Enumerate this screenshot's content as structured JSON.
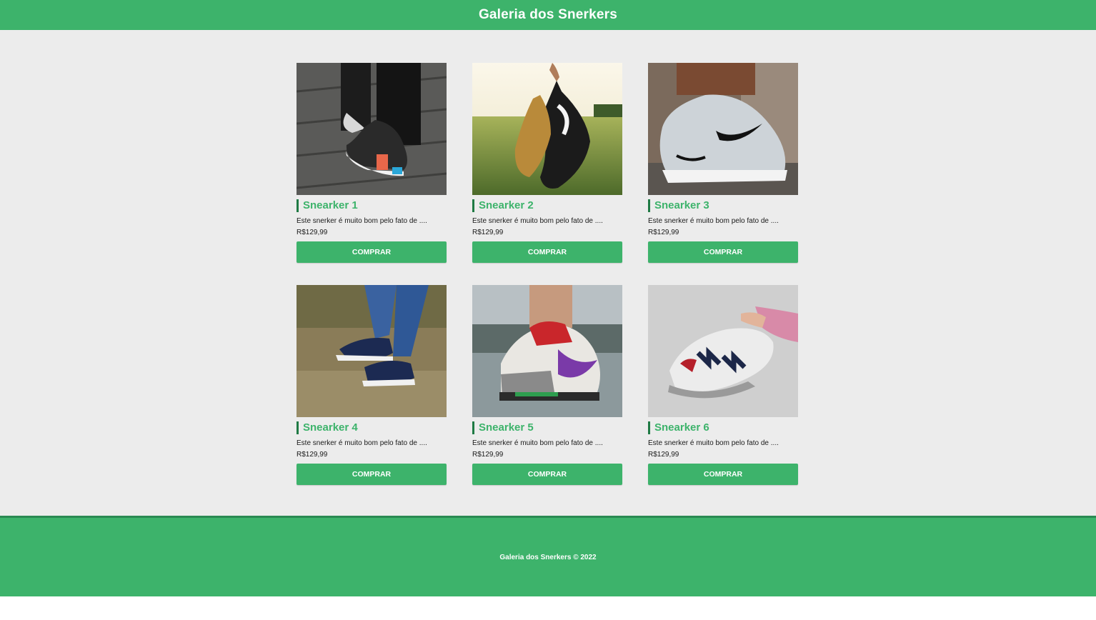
{
  "header": {
    "title": "Galeria dos Snerkers"
  },
  "products": [
    {
      "name": "Snearker 1",
      "description": "Este snerker é muito bom pelo fato de ....",
      "price": "R$129,99",
      "button_label": "COMPRAR",
      "image_icon": "sneaker-photo-icon"
    },
    {
      "name": "Snearker 2",
      "description": "Este snerker é muito bom pelo fato de ....",
      "price": "R$129,99",
      "button_label": "COMPRAR",
      "image_icon": "sneaker-photo-icon"
    },
    {
      "name": "Snearker 3",
      "description": "Este snerker é muito bom pelo fato de ....",
      "price": "R$129,99",
      "button_label": "COMPRAR",
      "image_icon": "sneaker-photo-icon"
    },
    {
      "name": "Snearker 4",
      "description": "Este snerker é muito bom pelo fato de ....",
      "price": "R$129,99",
      "button_label": "COMPRAR",
      "image_icon": "sneaker-photo-icon"
    },
    {
      "name": "Snearker 5",
      "description": "Este snerker é muito bom pelo fato de ....",
      "price": "R$129,99",
      "button_label": "COMPRAR",
      "image_icon": "sneaker-photo-icon"
    },
    {
      "name": "Snearker 6",
      "description": "Este snerker é muito bom pelo fato de ....",
      "price": "R$129,99",
      "button_label": "COMPRAR",
      "image_icon": "sneaker-photo-icon"
    }
  ],
  "footer": {
    "text": "Galeria dos Snerkers © 2022"
  },
  "colors": {
    "brand": "#3db36b",
    "brand_dark": "#1f7a44",
    "background": "#ececec"
  }
}
